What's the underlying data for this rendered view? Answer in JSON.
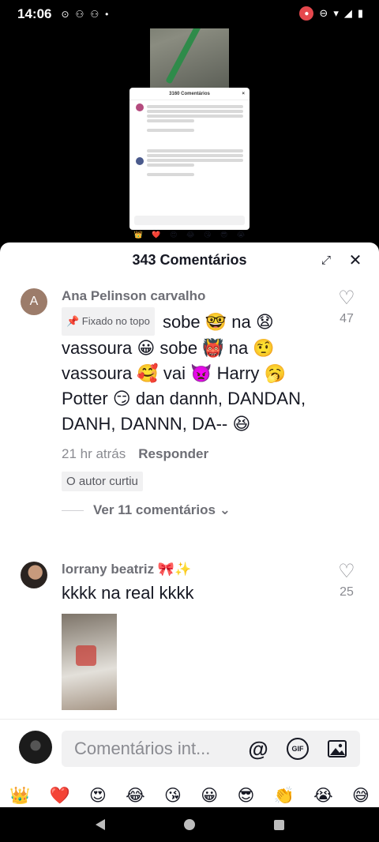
{
  "status_bar": {
    "time": "14:06",
    "left_icons": [
      "⊙",
      "⚇",
      "⚇",
      "•"
    ],
    "right_icons": [
      "⊖",
      "▾",
      "◢",
      "▮"
    ]
  },
  "sheet": {
    "title": "343 Comentários"
  },
  "comments": [
    {
      "avatar_letter": "A",
      "username": "Ana Pelinson carvalho",
      "pinned_label": "📌 Fixado no topo",
      "text": "sobe 🤓 na 😧 vassoura 😀 sobe 👹 na 🤨 vassoura 🥰 vai 👿 Harry 🥱 Potter 😏 dan dannh, DANDAN, DANH, DANNN, DA-- 😆",
      "time": "21 hr atrás",
      "reply_label": "Responder",
      "author_liked": "O autor curtiu",
      "view_more": "Ver 11 comentários ⌄",
      "likes": "47"
    },
    {
      "username": "lorrany beatriz 🎀✨",
      "text": "kkkk na real kkkk",
      "likes": "25"
    }
  ],
  "input": {
    "placeholder": "Comentários int...",
    "at_label": "@",
    "gif_label": "GIF"
  },
  "emoji_row": [
    "👑",
    "❤️",
    "😍",
    "😂",
    "😘",
    "😀",
    "😎",
    "👏",
    "😭",
    "😅"
  ]
}
